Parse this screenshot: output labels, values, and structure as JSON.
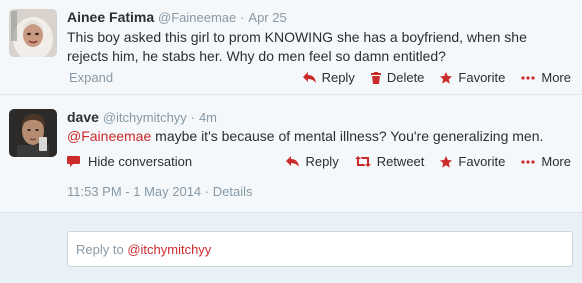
{
  "colors": {
    "accent": "#cc2b2b",
    "muted": "#8899a6",
    "text": "#292f33",
    "background": "#f5f8fa"
  },
  "tweets": [
    {
      "name": "Ainee Fatima",
      "handle": "@Faineemae",
      "separator": "·",
      "time": "Apr 25",
      "text": "This boy asked this girl to prom KNOWING she has a boyfriend, when she rejects him, he stabs her. Why do men feel so damn entitled?",
      "expand_label": "Expand",
      "actions": {
        "reply": "Reply",
        "delete": "Delete",
        "favorite": "Favorite",
        "more": "More"
      },
      "avatar_icon": "avatar-hijab-woman"
    },
    {
      "name": "dave",
      "handle": "@itchymitchyy",
      "separator": "·",
      "time": "4m",
      "mention": "@Faineemae",
      "text": " maybe it's because of mental illness? You're generalizing men.",
      "hide_label": "Hide conversation",
      "actions": {
        "reply": "Reply",
        "retweet": "Retweet",
        "favorite": "Favorite",
        "more": "More"
      },
      "timestamp": "11:53 PM - 1 May 2014",
      "timestamp_sep": "·",
      "details_label": "Details",
      "avatar_icon": "avatar-young-man"
    }
  ],
  "reply_box": {
    "prefix": "Reply to ",
    "mention": "@itchymitchyy"
  }
}
